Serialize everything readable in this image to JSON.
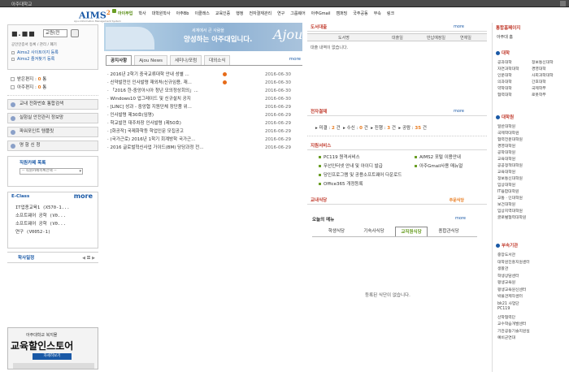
{
  "window": {
    "title": "아주대학교"
  },
  "logo": {
    "main": "AIMS",
    "sup": "2",
    "sub": "Ajou Information Management System"
  },
  "gnb": [
    "아이부업",
    "학사",
    "대학원학사",
    "아주Bb",
    "이클래스",
    "교육인증",
    "행정",
    "전자결재관리",
    "연구",
    "그룹웨어",
    "아주Gmail",
    "캠퍼밍",
    "국주공동",
    "부속",
    "링크"
  ],
  "profile": {
    "name": "■.■■",
    "role": "교원(전",
    "links": "공인인증서 등록 / 관리 / 폐기",
    "link1": "Aims2 사이트이지 등록",
    "link2": "Aims2 즐겨찾기 등록"
  },
  "counts": [
    {
      "label": "받은편지",
      "num": "0",
      "unit": "통"
    },
    {
      "label": "아주편지",
      "num": "0",
      "unit": "통"
    }
  ],
  "menu_buttons": [
    "교내 전화번호 통합검색",
    "실험실 안전관리 정보망",
    "파워포인트 템플릿",
    "명 함 신 청"
  ],
  "favorites": {
    "title": "직원카페 목록",
    "select": "-- 직원카페목록선택 --"
  },
  "eclass": {
    "title": "E-Class",
    "more": "more",
    "items": [
      "IT업종교육1 (X570-1...",
      "소프트웨어 공학 (V0...",
      "소프트웨어 공학 (V0...",
      "연구 (V0052-1)"
    ]
  },
  "schedule": {
    "title": "학사일정",
    "icons": "◀ 〓 ▶"
  },
  "ad": {
    "small": "아주대학교 복지몰",
    "big": "교육할인스토어",
    "button": "자세히보기"
  },
  "banner": {
    "line1": "세계에서 큰 사람을",
    "line2": "양성하는 아주대입니다.",
    "signature": "Ajou"
  },
  "notice_tabs": {
    "tabs": [
      "공지사항",
      "Ajou News",
      "세미나/포럼",
      "대외소식"
    ],
    "active": 0,
    "more": "more"
  },
  "notices": [
    {
      "title": "2016년 2학기 중국교류대학 안내 성별 ...",
      "date": "2016-06-30",
      "new": true
    },
    {
      "title": "신약발전인 인사발령 재외처(신규임용, 재...",
      "date": "2016-06-30",
      "new": true
    },
    {
      "title": "「2016 한-중앙아시아 청년 모의정상회의」...",
      "date": "2016-06-30",
      "new": false
    },
    {
      "title": "Windows10 업그레이드 및 신규설치 공지",
      "date": "2016-06-30",
      "new": false
    },
    {
      "title": "[LINC] 성과 - 중앙협 지원단체 장단품 위...",
      "date": "2016-06-29",
      "new": false
    },
    {
      "title": "인사발령 제30호(임명)",
      "date": "2016-06-29",
      "new": false
    },
    {
      "title": "학교발전 대주차장 인사발령 (제50호)",
      "date": "2016-06-29",
      "new": false
    },
    {
      "title": "[화공작] 국제화학등 학업인문 모집공고",
      "date": "2016-06-29",
      "new": false
    },
    {
      "title": "(국가근로) 2016년 1학기 회계방학 국가근...",
      "date": "2016-06-29",
      "new": false
    },
    {
      "title": "2016 글로벌혁신사업 가이드(BM) 당당과정 전...",
      "date": "2016-06-29",
      "new": false
    }
  ],
  "library": {
    "title": "도서대출",
    "more": "more",
    "cols": [
      "도서명",
      "대출일",
      "반납예정일",
      "연체일"
    ],
    "empty": "대출 내역이 없습니다."
  },
  "payment": {
    "title": "전자결재",
    "more": "more",
    "items": [
      {
        "label": "미결",
        "num": "2",
        "unit": "건"
      },
      {
        "label": "수신",
        "num": "0",
        "unit": "건"
      },
      {
        "label": "진행",
        "num": "3",
        "unit": "건"
      },
      {
        "label": "공람",
        "num": "35",
        "unit": "건"
      }
    ]
  },
  "support": {
    "title": "지원서비스",
    "items": [
      "PC119 원격서비스",
      "AIMS2 포털 이용안내",
      "무선인터넷 안내 및 아이디 발급",
      "아주Gmail사용 매뉴얼",
      "당인프로그램 및 공용소프트웨어 다운로드",
      "Office365 개정등록"
    ]
  },
  "cafe": {
    "title": "교내식당",
    "link": "주문식당",
    "more": "more",
    "today": "오늘의 메뉴",
    "tabs": [
      "학생식당",
      "기숙사식당",
      "교직원식당",
      "종합관식당"
    ],
    "active": 2,
    "empty": "등록된 식단이 없습니다."
  },
  "right": {
    "h1": "통합홈페이지",
    "sub": "아주대 홈",
    "college_title": "대학",
    "colleges": [
      "공과대학",
      "정보통신대학",
      "자연과학대학",
      "경영대학",
      "인문대학",
      "사회과학대학",
      "의과대학",
      "간호대학",
      "약학대학",
      "국제학부",
      "협력대학",
      "로봇학부"
    ],
    "grad_title": "대학원",
    "grads": [
      "일반대학원",
      "국제학대학원",
      "협력전문대학원",
      "경영대학원",
      "공학대학원",
      "교육대학원",
      "공공정책대학원",
      "교육대학원",
      "정보통신대학원",
      "임상대학원",
      "IT융합대학원",
      "교통ㆍ인대학원",
      "보건대학원",
      "임상지역대학원",
      "글로벌협력대학원"
    ],
    "inst_title": "부속기관",
    "insts": [
      "중앙도서관",
      "대학원진흥지원센터",
      "생활관",
      "학생상담센터",
      "평생교육원",
      "평생교육원신센터",
      "박물관제작센터",
      "bk21 사업단",
      "PC119",
      "산학협력단",
      "교수학습개발센터",
      "기관공동기술지원실",
      "예비군연대"
    ]
  }
}
